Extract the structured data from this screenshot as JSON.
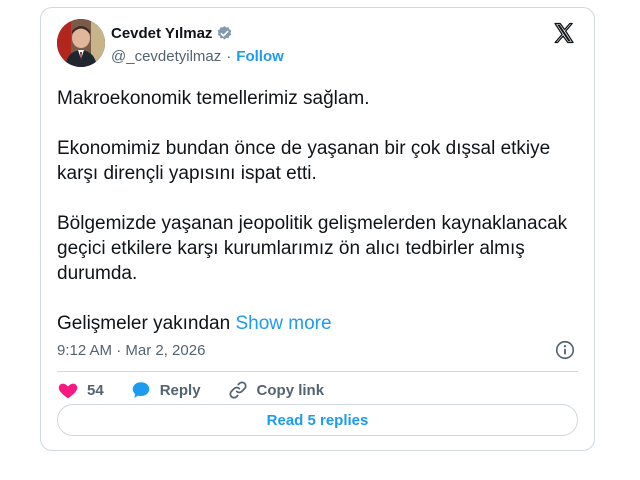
{
  "author": {
    "display_name": "Cevdet Yılmaz",
    "handle": "@_cevdetyilmaz",
    "separator": "·",
    "follow_label": "Follow"
  },
  "tweet": {
    "paragraphs": [
      "Makroekonomik temellerimiz sağlam.",
      "Ekonomimiz bundan önce de yaşanan bir çok dışsal etkiye karşı dirençli yapısını ispat etti.",
      "Bölgemizde yaşanan jeopolitik gelişmelerden kaynaklanacak geçici etkilere karşı kurumlarımız ön alıcı tedbirler almış durumda."
    ],
    "last_line": "Gelişmeler yakından",
    "show_more_label": "Show more",
    "timestamp": "9:12 AM · Mar 2, 2026"
  },
  "actions": {
    "like_count": "54",
    "reply_label": "Reply",
    "copy_link_label": "Copy link",
    "read_replies_label": "Read 5 replies"
  },
  "icons": {
    "logo": "x-logo-icon",
    "verified": "verified-badge-icon",
    "info": "info-icon",
    "like": "heart-icon",
    "reply": "speech-bubble-icon",
    "copy_link": "link-icon"
  },
  "colors": {
    "accent": "#1d9bf0",
    "like": "#f91880",
    "text": "#0f1419",
    "secondary_text": "#536471",
    "border": "#cfd9de"
  }
}
